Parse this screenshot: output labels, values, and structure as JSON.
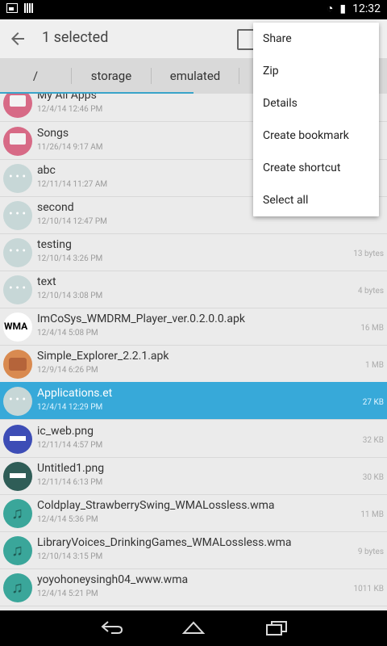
{
  "status": {
    "time": "12:32"
  },
  "actionbar": {
    "title": "1 selected"
  },
  "path_tabs": [
    {
      "label": "/"
    },
    {
      "label": "storage"
    },
    {
      "label": "emulated"
    }
  ],
  "menu": {
    "items": [
      {
        "label": "Share"
      },
      {
        "label": "Zip"
      },
      {
        "label": "Details"
      },
      {
        "label": "Create bookmark"
      },
      {
        "label": "Create shortcut"
      },
      {
        "label": "Select all"
      }
    ]
  },
  "files": [
    {
      "name": "My All Apps",
      "date": "12/4/14 12:46 PM",
      "size": "",
      "icon": "folder-pink-icon"
    },
    {
      "name": "Songs",
      "date": "11/26/14 9:17 AM",
      "size": "",
      "icon": "folder-pink-icon"
    },
    {
      "name": "abc",
      "date": "12/11/14 11:27 AM",
      "size": "",
      "icon": "file-dots-icon"
    },
    {
      "name": "second",
      "date": "12/10/14 12:47 PM",
      "size": "",
      "icon": "file-dots-icon"
    },
    {
      "name": "testing",
      "date": "12/10/14 3:26 PM",
      "size": "13 bytes",
      "icon": "file-dots-icon"
    },
    {
      "name": "text",
      "date": "12/10/14 3:08 PM",
      "size": "4 bytes",
      "icon": "file-dots-icon"
    },
    {
      "name": "ImCoSys_WMDRM_Player_ver.0.2.0.0.apk",
      "date": "12/4/14 5:08 PM",
      "size": "16 MB",
      "icon": "wma-icon"
    },
    {
      "name": "Simple_Explorer_2.2.1.apk",
      "date": "12/9/14 6:26 PM",
      "size": "1 MB",
      "icon": "apk-icon"
    },
    {
      "name": "Applications.et",
      "date": "12/4/14 12:29 PM",
      "size": "27 KB",
      "icon": "file-dots-icon",
      "selected": true
    },
    {
      "name": "ic_web.png",
      "date": "12/11/14 4:57 PM",
      "size": "32 KB",
      "icon": "image-blue-icon"
    },
    {
      "name": "Untitled1.png",
      "date": "12/11/14 6:13 PM",
      "size": "30 KB",
      "icon": "image-green-icon"
    },
    {
      "name": "Coldplay_StrawberrySwing_WMALossless.wma",
      "date": "12/4/14 5:36 PM",
      "size": "11 MB",
      "icon": "music-icon"
    },
    {
      "name": "LibraryVoices_DrinkingGames_WMALossless.wma",
      "date": "12/10/14 3:15 PM",
      "size": "9 bytes",
      "icon": "music-icon"
    },
    {
      "name": "yoyohoneysingh04_www.wma",
      "date": "12/4/14 5:21 PM",
      "size": "1011 KB",
      "icon": "music-icon"
    }
  ],
  "colors": {
    "accent": "#37a9d9",
    "statusbar": "#000000",
    "actionbar": "#efefef"
  }
}
